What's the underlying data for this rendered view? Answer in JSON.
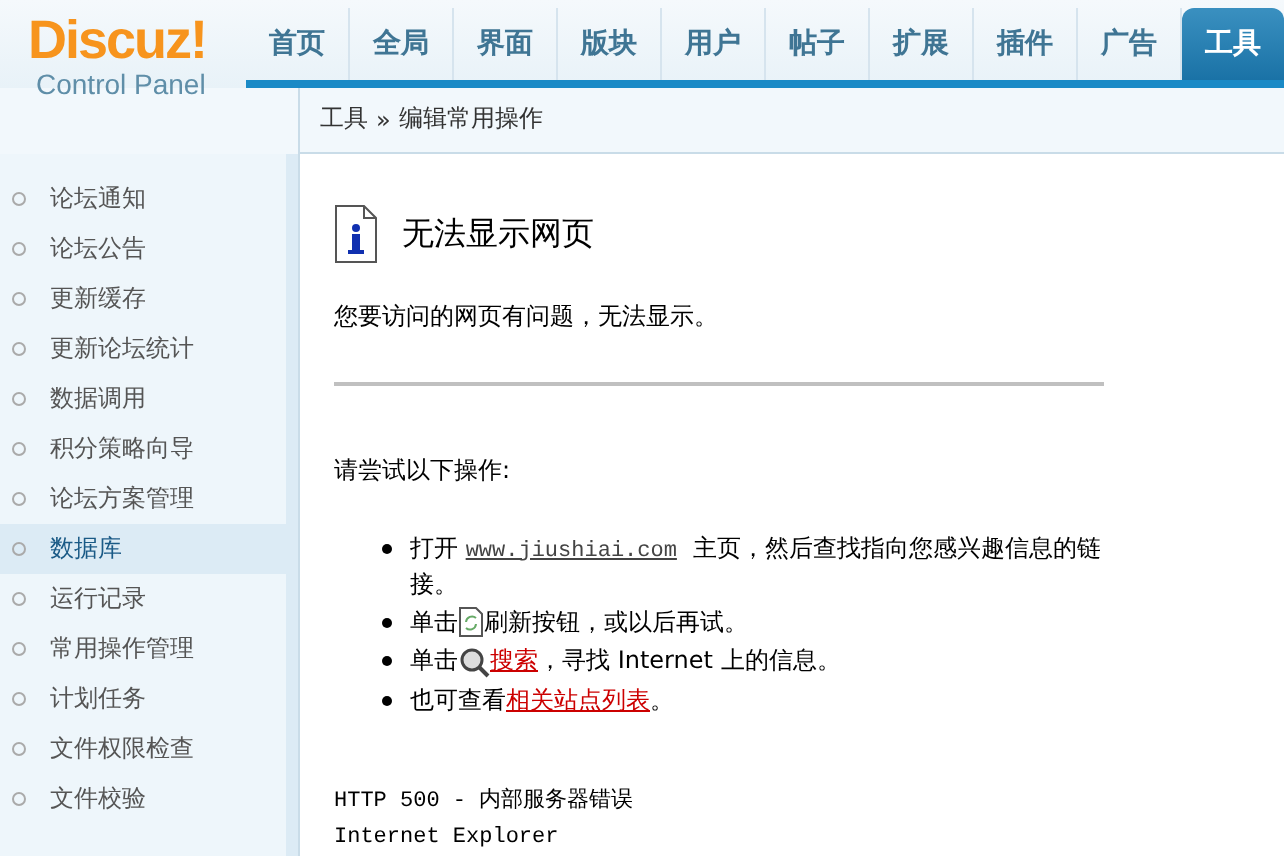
{
  "logo": {
    "title": "Discuz!",
    "subtitle": "Control Panel"
  },
  "nav": [
    {
      "label": "首页",
      "selected": false
    },
    {
      "label": "全局",
      "selected": false
    },
    {
      "label": "界面",
      "selected": false
    },
    {
      "label": "版块",
      "selected": false
    },
    {
      "label": "用户",
      "selected": false
    },
    {
      "label": "帖子",
      "selected": false
    },
    {
      "label": "扩展",
      "selected": false
    },
    {
      "label": "插件",
      "selected": false
    },
    {
      "label": "广告",
      "selected": false
    },
    {
      "label": "工具",
      "selected": true
    }
  ],
  "breadcrumb": {
    "parent": "工具",
    "separator": "»",
    "current": "编辑常用操作"
  },
  "sidebar": {
    "items": [
      {
        "label": "论坛通知",
        "selected": false
      },
      {
        "label": "论坛公告",
        "selected": false
      },
      {
        "label": "更新缓存",
        "selected": false
      },
      {
        "label": "更新论坛统计",
        "selected": false
      },
      {
        "label": "数据调用",
        "selected": false
      },
      {
        "label": "积分策略向导",
        "selected": false
      },
      {
        "label": "论坛方案管理",
        "selected": false
      },
      {
        "label": "数据库",
        "selected": true
      },
      {
        "label": "运行记录",
        "selected": false
      },
      {
        "label": "常用操作管理",
        "selected": false
      },
      {
        "label": "计划任务",
        "selected": false
      },
      {
        "label": "文件权限检查",
        "selected": false
      },
      {
        "label": "文件校验",
        "selected": false
      }
    ]
  },
  "error_page": {
    "title": "无法显示网页",
    "message": "您要访问的网页有问题，无法显示。",
    "try_heading": "请尝试以下操作:",
    "suggestions": [
      {
        "kind": "url",
        "before": "打开",
        "link": "www.jiushiai.com",
        "after": "主页，然后查找指向您感兴趣信息的链接。"
      },
      {
        "kind": "refresh",
        "before": "单击",
        "after": "刷新按钮，或以后再试。"
      },
      {
        "kind": "search",
        "before": "单击",
        "link": "搜索",
        "after": "，寻找 Internet 上的信息。"
      },
      {
        "kind": "link",
        "before": "也可查看",
        "link": "相关站点列表",
        "after": "。"
      }
    ],
    "error_code": "HTTP 500 - 内部服务器错误",
    "browser": "Internet Explorer"
  }
}
